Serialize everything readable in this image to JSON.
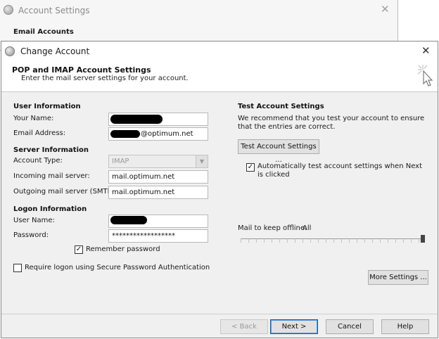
{
  "background_window": {
    "title": "Account Settings",
    "section": "Email Accounts"
  },
  "dialog": {
    "title": "Change Account",
    "header_title": "POP and IMAP Account Settings",
    "header_subtitle": "Enter the mail server settings for your account."
  },
  "user_info": {
    "section": "User Information",
    "name_label": "Your Name:",
    "email_label": "Email Address:",
    "email_value": "@optimum.net"
  },
  "server_info": {
    "section": "Server Information",
    "account_type_label": "Account Type:",
    "account_type_value": "IMAP",
    "incoming_label": "Incoming mail server:",
    "incoming_value": "mail.optimum.net",
    "outgoing_label": "Outgoing mail server (SMTP):",
    "outgoing_value": "mail.optimum.net"
  },
  "logon_info": {
    "section": "Logon Information",
    "username_label": "User Name:",
    "password_label": "Password:",
    "password_value": "******************",
    "remember_label": "Remember password",
    "remember_checked": true,
    "spa_label": "Require logon using Secure Password Authentication",
    "spa_checked": false
  },
  "test_settings": {
    "section": "Test Account Settings",
    "description": "We recommend that you test your account to ensure that the entries are correct.",
    "button": "Test Account Settings ...",
    "auto_test_label": "Automatically test account settings when Next is clicked",
    "auto_test_checked": true
  },
  "offline": {
    "label": "Mail to keep offline:",
    "value": "All",
    "slider_level": 1.0
  },
  "buttons": {
    "more_settings": "More Settings ...",
    "back": "< Back",
    "next": "Next >",
    "cancel": "Cancel",
    "help": "Help"
  },
  "icons": {
    "check": "✓",
    "close": "✕",
    "dropdown": "▼"
  }
}
